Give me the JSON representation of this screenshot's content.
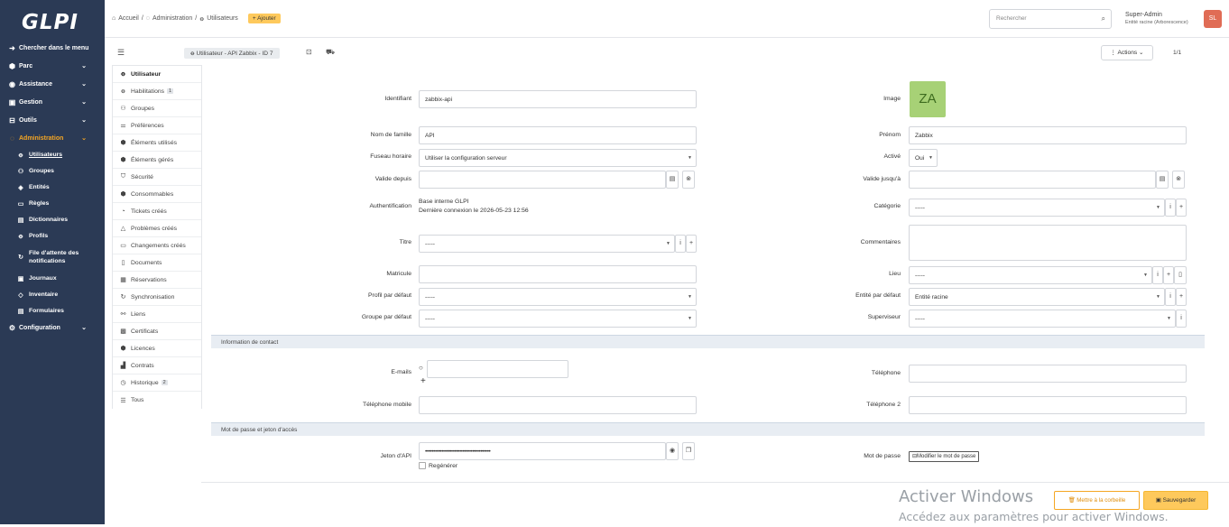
{
  "app": {
    "logo": "GLPI"
  },
  "sidebar": {
    "search": "Chercher dans le menu",
    "items": [
      {
        "label": "Parc",
        "icon": "box-icon"
      },
      {
        "label": "Assistance",
        "icon": "headset-icon"
      },
      {
        "label": "Gestion",
        "icon": "wallet-icon"
      },
      {
        "label": "Outils",
        "icon": "briefcase-icon"
      },
      {
        "label": "Administration",
        "icon": "shield-icon"
      },
      {
        "label": "Configuration",
        "icon": "gear-icon"
      }
    ],
    "subitems": [
      {
        "label": "Utilisateurs"
      },
      {
        "label": "Groupes"
      },
      {
        "label": "Entités"
      },
      {
        "label": "Règles"
      },
      {
        "label": "Dictionnaires"
      },
      {
        "label": "Profils"
      },
      {
        "label": "File d'attente des",
        "label2": "notifications"
      },
      {
        "label": "Journaux"
      },
      {
        "label": "Inventaire"
      },
      {
        "label": "Formulaires"
      }
    ]
  },
  "topbar": {
    "breadcrumb": [
      "Accueil",
      "Administration",
      "Utilisateurs"
    ],
    "add": "Ajouter",
    "search_placeholder": "Rechercher",
    "user_name": "Super-Admin",
    "user_entity": "Entité racine (Arborescence)",
    "avatar": "SL"
  },
  "header": {
    "title": "Utilisateur - API Zabbix - ID 7",
    "actions": "Actions",
    "pager": "1/1"
  },
  "tabs": [
    {
      "label": "Utilisateur"
    },
    {
      "label": "Habilitations",
      "count": "1"
    },
    {
      "label": "Groupes"
    },
    {
      "label": "Préférences"
    },
    {
      "label": "Éléments utilisés"
    },
    {
      "label": "Éléments gérés"
    },
    {
      "label": "Sécurité"
    },
    {
      "label": "Consommables"
    },
    {
      "label": "Tickets créés"
    },
    {
      "label": "Problèmes créés"
    },
    {
      "label": "Changements créés"
    },
    {
      "label": "Documents"
    },
    {
      "label": "Réservations"
    },
    {
      "label": "Synchronisation"
    },
    {
      "label": "Liens"
    },
    {
      "label": "Certificats"
    },
    {
      "label": "Licences"
    },
    {
      "label": "Contrats"
    },
    {
      "label": "Historique",
      "count": "2"
    },
    {
      "label": "Tous"
    }
  ],
  "form": {
    "identifiant_label": "Identifiant",
    "identifiant": "zabbix-api",
    "image_label": "Image",
    "image_initials": "ZA",
    "nom_label": "Nom de famille",
    "nom": "API",
    "prenom_label": "Prénom",
    "prenom": "Zabbix",
    "fuseau_label": "Fuseau horaire",
    "fuseau": "Utiliser la configuration serveur",
    "active_label": "Activé",
    "active": "Oui",
    "valide_depuis_label": "Valide depuis",
    "valide_jusqua_label": "Valide jusqu'à",
    "auth_label": "Authentification",
    "auth_line1": "Base interne GLPI",
    "auth_line2": "Dernière connexion le 2026-05-23 12:56",
    "categorie_label": "Catégorie",
    "categorie": "-----",
    "titre_label": "Titre",
    "titre": "-----",
    "commentaires_label": "Commentaires",
    "matricule_label": "Matricule",
    "lieu_label": "Lieu",
    "lieu": "-----",
    "profil_label": "Profil par défaut",
    "profil": "-----",
    "entite_label": "Entité par défaut",
    "entite": "Entité racine",
    "groupe_label": "Groupe par défaut",
    "groupe": "-----",
    "superviseur_label": "Superviseur",
    "superviseur": "-----",
    "section_contact": "Information de contact",
    "emails_label": "E-mails",
    "telephone_label": "Téléphone",
    "mobile_label": "Téléphone mobile",
    "telephone2_label": "Téléphone 2",
    "section_password": "Mot de passe et jeton d'accès",
    "jeton_label": "Jeton d'API",
    "jeton": "••••••••••••••••••••••••••••••••••••••••",
    "regenerer": "Regénérer",
    "mdp_label": "Mot de passe",
    "mdp_button": "Modifier le mot de passe"
  },
  "footer": {
    "trash": "Mettre à la corbeille",
    "save": "Sauvegarder",
    "watermark_title": "Activer Windows",
    "watermark_sub": "Accédez aux paramètres pour activer Windows."
  }
}
